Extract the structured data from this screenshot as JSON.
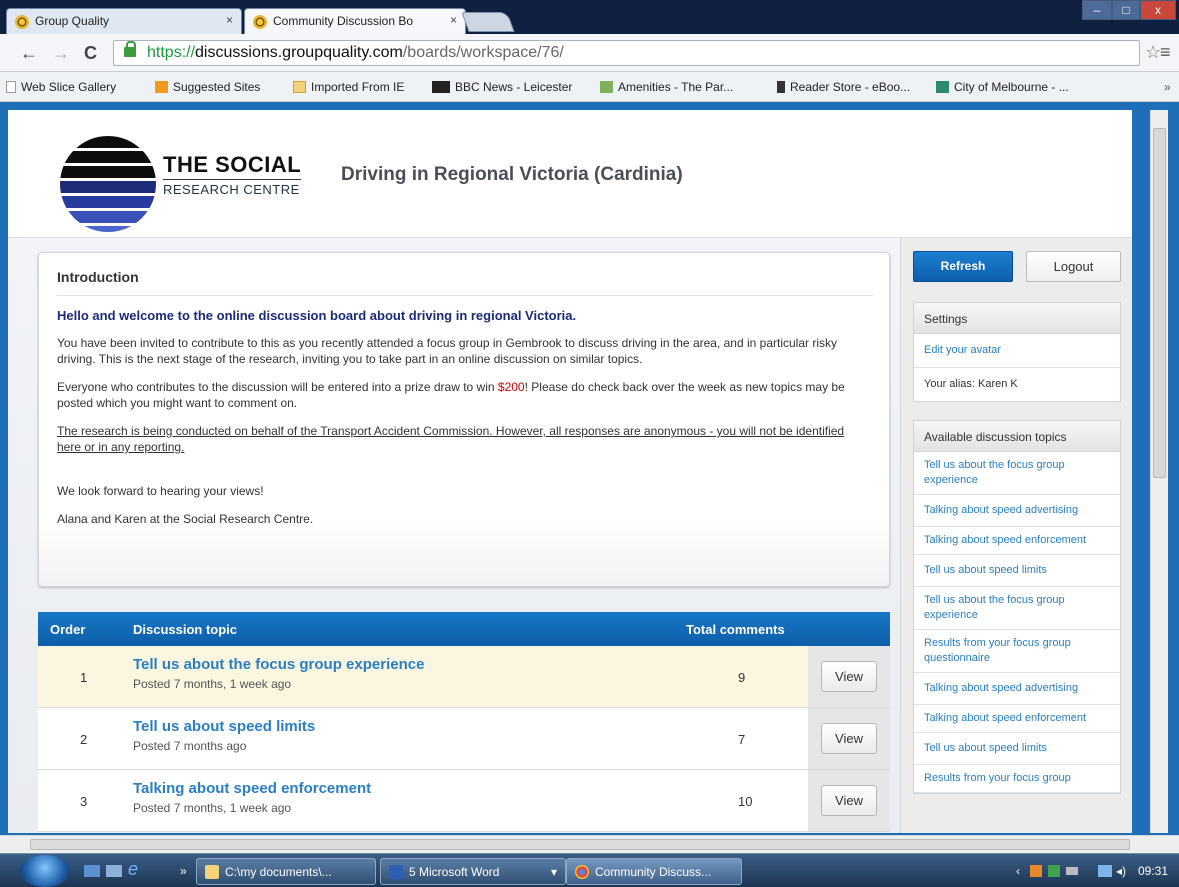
{
  "browser": {
    "tabs": [
      {
        "label": "Group Quality",
        "close": "×"
      },
      {
        "label": "Community Discussion Bo",
        "close": "×"
      }
    ],
    "window_controls": {
      "minimize": "–",
      "maximize": "□",
      "close": "x"
    },
    "url": {
      "scheme": "https://",
      "host": "discussions.groupquality.com",
      "path": "/boards/workspace/76/"
    },
    "bookmarks": [
      {
        "label": "Web Slice Gallery",
        "icon": "page-icon",
        "color": "#ffffff"
      },
      {
        "label": "Suggested Sites",
        "icon": "suggested-icon",
        "color": "#f39a1e"
      },
      {
        "label": "Imported From IE",
        "icon": "folder-icon",
        "color": "#f3d27a"
      },
      {
        "label": "BBC News - Leicester",
        "icon": "bbc-icon",
        "color": "#222222"
      },
      {
        "label": "Amenities - The Par...",
        "icon": "amenities-icon",
        "color": "#7fb15a"
      },
      {
        "label": "Reader Store - eBoo...",
        "icon": "reader-icon",
        "color": "#333333"
      },
      {
        "label": "City of Melbourne - ...",
        "icon": "melbourne-icon",
        "color": "#2d8a6e"
      }
    ],
    "bookmarks_more": "»"
  },
  "header": {
    "brand_line1": "THE SOCIAL",
    "brand_line2": "RESEARCH CENTRE",
    "site_title": "Driving in Regional Victoria (Cardinia)"
  },
  "intro": {
    "heading": "Introduction",
    "welcome": "Hello and welcome to the online discussion board about driving in regional Victoria.",
    "p1": "You have been invited to contribute to this as you recently attended a focus group in Gembrook to discuss driving in the area, and in particular risky driving.  This is the next stage of the research, inviting you to take part in an online discussion on similar topics.",
    "p2_before": "Everyone who contributes to the discussion will be entered into a prize draw to win ",
    "p2_prize": "$200",
    "p2_after": "! Please do check back over the week as new topics may be posted which you might want to comment on.",
    "p3": "The research is being conducted on behalf of the Transport Accident Commission. However, all responses are anonymous - you will not be identified here or in any reporting.",
    "p4": "We look forward to hearing your views!",
    "p5": "Alana and Karen at the Social Research Centre."
  },
  "table": {
    "headers": {
      "order": "Order",
      "topic": "Discussion topic",
      "comments": "Total comments"
    },
    "rows": [
      {
        "order": "1",
        "title": "Tell us about the focus group experience",
        "posted": "Posted 7 months, 1 week ago",
        "comments": "9",
        "action": "View"
      },
      {
        "order": "2",
        "title": "Tell us about speed limits",
        "posted": "Posted 7 months ago",
        "comments": "7",
        "action": "View"
      },
      {
        "order": "3",
        "title": "Talking about speed enforcement",
        "posted": "Posted 7 months, 1 week ago",
        "comments": "10",
        "action": "View"
      }
    ]
  },
  "sidebar": {
    "refresh": "Refresh",
    "logout": "Logout",
    "settings": {
      "heading": "Settings",
      "edit_avatar": "Edit your avatar",
      "alias": "Your alias: Karen K"
    },
    "topics": {
      "heading": "Available discussion topics",
      "items": [
        "Tell us about the focus group experience",
        "Talking about speed advertising",
        "Talking about speed enforcement",
        "Tell us about speed limits",
        "Tell us about the focus group experience",
        "Results from your focus group questionnaire",
        "Talking about speed advertising",
        "Talking about speed enforcement",
        "Tell us about speed limits",
        "Results from your focus group"
      ]
    }
  },
  "taskbar": {
    "quicklaunch_more": "»",
    "items": [
      {
        "label": "C:\\my documents\\...",
        "icon": "folder-icon"
      },
      {
        "label": "5 Microsoft Word",
        "icon": "word-icon"
      },
      {
        "label": "Community Discuss...",
        "icon": "chrome-icon"
      }
    ],
    "clock": "09:31"
  },
  "colors": {
    "brand_blue": "#1f6fb8",
    "link": "#2a7fc2",
    "prize": "#d00000",
    "welcome": "#1c2a7a"
  }
}
